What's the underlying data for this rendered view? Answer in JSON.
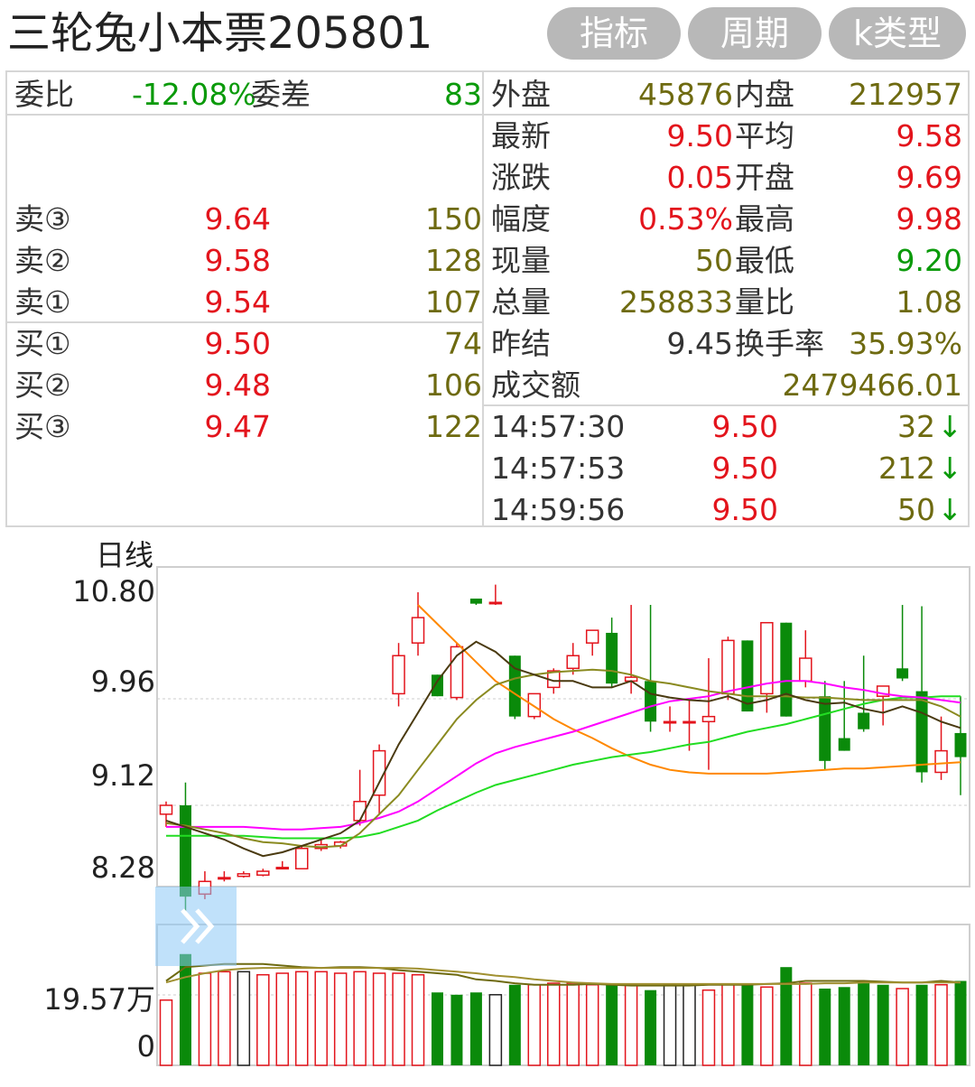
{
  "header": {
    "title": "三轮兔小本票205801",
    "buttons": [
      "指标",
      "周期",
      "k类型"
    ]
  },
  "order_book": {
    "weibi_label": "委比",
    "weibi_value": "-12.08%",
    "weicha_label": "委差",
    "weicha_value": "83",
    "sell": [
      {
        "label": "卖③",
        "price": "9.64",
        "volume": "150"
      },
      {
        "label": "卖②",
        "price": "9.58",
        "volume": "128"
      },
      {
        "label": "卖①",
        "price": "9.54",
        "volume": "107"
      }
    ],
    "buy": [
      {
        "label": "买①",
        "price": "9.50",
        "volume": "74"
      },
      {
        "label": "买②",
        "price": "9.48",
        "volume": "106"
      },
      {
        "label": "买③",
        "price": "9.47",
        "volume": "122"
      }
    ]
  },
  "stats": {
    "waipan_label": "外盘",
    "waipan_value": "45876",
    "neipan_label": "内盘",
    "neipan_value": "212957",
    "zuixin_label": "最新",
    "zuixin_value": "9.50",
    "pingjun_label": "平均",
    "pingjun_value": "9.58",
    "zhangdie_label": "涨跌",
    "zhangdie_value": "0.05",
    "kaipan_label": "开盘",
    "kaipan_value": "9.69",
    "fudu_label": "幅度",
    "fudu_value": "0.53%",
    "zuigao_label": "最高",
    "zuigao_value": "9.98",
    "xianliang_label": "现量",
    "xianliang_value": "50",
    "zuidi_label": "最低",
    "zuidi_value": "9.20",
    "zongliang_label": "总量",
    "zongliang_value": "258833",
    "liangbi_label": "量比",
    "liangbi_value": "1.08",
    "zuojie_label": "昨结",
    "zuojie_value": "9.45",
    "huanshou_label": "换手率",
    "huanshou_value": "35.93%",
    "chengjiao_label": "成交额",
    "chengjiao_value": "2479466.01"
  },
  "ticks": [
    {
      "time": "14:57:30",
      "price": "9.50",
      "volume": "32",
      "arrow": "↓"
    },
    {
      "time": "14:57:53",
      "price": "9.50",
      "volume": "212",
      "arrow": "↓"
    },
    {
      "time": "14:59:56",
      "price": "9.50",
      "volume": "50",
      "arrow": "↓"
    }
  ],
  "chart_data": {
    "type": "candlestick",
    "period_label": "日线",
    "price_axis": {
      "ticks": [
        "10.80",
        "9.96",
        "9.12",
        "8.28"
      ],
      "range": [
        8.28,
        10.8
      ]
    },
    "volume_axis": {
      "ticks": [
        "19.57万",
        "0"
      ]
    },
    "colors": {
      "up": "#e3141c",
      "down": "#0a8a0a",
      "ma5": "#4a3a10",
      "ma10": "#8a8a20",
      "ma20": "#ff00ff",
      "ma30": "#22dd22",
      "ma60": "#ff8800"
    },
    "candles": [
      {
        "o": 9.05,
        "h": 9.15,
        "l": 8.95,
        "c": 9.12
      },
      {
        "o": 9.12,
        "h": 9.3,
        "l": 8.25,
        "c": 8.4
      },
      {
        "o": 8.42,
        "h": 8.6,
        "l": 8.38,
        "c": 8.52
      },
      {
        "o": 8.55,
        "h": 8.6,
        "l": 8.52,
        "c": 8.55
      },
      {
        "o": 8.56,
        "h": 8.6,
        "l": 8.55,
        "c": 8.58
      },
      {
        "o": 8.57,
        "h": 8.62,
        "l": 8.56,
        "c": 8.6
      },
      {
        "o": 8.63,
        "h": 8.68,
        "l": 8.62,
        "c": 8.63
      },
      {
        "o": 8.62,
        "h": 8.8,
        "l": 8.62,
        "c": 8.78
      },
      {
        "o": 8.78,
        "h": 8.85,
        "l": 8.76,
        "c": 8.81
      },
      {
        "o": 8.8,
        "h": 8.84,
        "l": 8.78,
        "c": 8.83
      },
      {
        "o": 9.0,
        "h": 9.4,
        "l": 8.96,
        "c": 9.15
      },
      {
        "o": 9.2,
        "h": 9.6,
        "l": 9.05,
        "c": 9.55
      },
      {
        "o": 10.0,
        "h": 10.4,
        "l": 9.9,
        "c": 10.3
      },
      {
        "o": 10.4,
        "h": 10.8,
        "l": 10.3,
        "c": 10.6
      },
      {
        "o": 10.15,
        "h": 10.15,
        "l": 9.98,
        "c": 9.98
      },
      {
        "o": 9.97,
        "h": 10.4,
        "l": 9.95,
        "c": 10.37
      },
      {
        "o": 10.75,
        "h": 10.75,
        "l": 10.7,
        "c": 10.71
      },
      {
        "o": 10.72,
        "h": 10.86,
        "l": 10.7,
        "c": 10.72
      },
      {
        "o": 10.3,
        "h": 10.3,
        "l": 9.8,
        "c": 9.82
      },
      {
        "o": 9.82,
        "h": 10.0,
        "l": 9.8,
        "c": 10.0
      },
      {
        "o": 10.05,
        "h": 10.2,
        "l": 10.0,
        "c": 10.18
      },
      {
        "o": 10.2,
        "h": 10.4,
        "l": 10.15,
        "c": 10.3
      },
      {
        "o": 10.4,
        "h": 10.5,
        "l": 10.3,
        "c": 10.5
      },
      {
        "o": 10.48,
        "h": 10.6,
        "l": 10.05,
        "c": 10.08
      },
      {
        "o": 10.1,
        "h": 10.7,
        "l": 10.0,
        "c": 10.13
      },
      {
        "o": 10.1,
        "h": 10.7,
        "l": 9.7,
        "c": 9.78
      },
      {
        "o": 9.78,
        "h": 9.9,
        "l": 9.7,
        "c": 9.78
      },
      {
        "o": 9.78,
        "h": 9.95,
        "l": 9.55,
        "c": 9.78
      },
      {
        "o": 9.78,
        "h": 10.28,
        "l": 9.4,
        "c": 9.82
      },
      {
        "o": 10.0,
        "h": 10.45,
        "l": 9.95,
        "c": 10.42
      },
      {
        "o": 10.42,
        "h": 10.42,
        "l": 9.86,
        "c": 9.86
      },
      {
        "o": 10.0,
        "h": 10.56,
        "l": 9.85,
        "c": 10.56
      },
      {
        "o": 10.56,
        "h": 10.56,
        "l": 9.82,
        "c": 9.82
      },
      {
        "o": 10.1,
        "h": 10.5,
        "l": 10.05,
        "c": 10.28
      },
      {
        "o": 9.98,
        "h": 10.1,
        "l": 9.4,
        "c": 9.47
      },
      {
        "o": 9.65,
        "h": 10.1,
        "l": 9.55,
        "c": 9.55
      },
      {
        "o": 9.85,
        "h": 10.3,
        "l": 9.7,
        "c": 9.72
      },
      {
        "o": 9.98,
        "h": 10.06,
        "l": 9.75,
        "c": 10.06
      },
      {
        "o": 10.2,
        "h": 10.7,
        "l": 10.1,
        "c": 10.12
      },
      {
        "o": 10.02,
        "h": 10.69,
        "l": 9.3,
        "c": 9.38
      },
      {
        "o": 9.38,
        "h": 9.82,
        "l": 9.32,
        "c": 9.55
      },
      {
        "o": 9.69,
        "h": 9.98,
        "l": 9.2,
        "c": 9.5
      }
    ],
    "ma_lines": {
      "ma5": [
        9.0,
        8.95,
        8.9,
        8.85,
        8.78,
        8.72,
        8.75,
        8.8,
        8.85,
        8.9,
        9.0,
        9.3,
        9.6,
        9.85,
        10.1,
        10.3,
        10.41,
        10.33,
        10.2,
        10.15,
        10.1,
        10.1,
        10.05,
        10.05,
        10.1,
        10.0,
        9.97,
        9.95,
        9.94,
        9.98,
        9.92,
        9.95,
        10.0,
        9.95,
        9.92,
        9.93,
        9.88,
        9.85,
        9.9,
        9.85,
        9.78,
        9.73
      ],
      "ma10": [
        8.98,
        8.96,
        8.93,
        8.9,
        8.86,
        8.83,
        8.82,
        8.8,
        8.79,
        8.8,
        8.9,
        9.05,
        9.2,
        9.4,
        9.6,
        9.8,
        9.95,
        10.07,
        10.12,
        10.15,
        10.17,
        10.18,
        10.19,
        10.18,
        10.15,
        10.1,
        10.08,
        10.05,
        10.02,
        10.0,
        9.98,
        9.98,
        9.98,
        9.97,
        9.97,
        9.96,
        9.95,
        9.95,
        9.95,
        9.95,
        9.9,
        9.82
      ],
      "ma20": [
        8.95,
        8.95,
        8.95,
        8.95,
        8.95,
        8.94,
        8.93,
        8.93,
        8.94,
        8.95,
        8.98,
        9.02,
        9.07,
        9.15,
        9.25,
        9.35,
        9.45,
        9.53,
        9.58,
        9.62,
        9.66,
        9.7,
        9.75,
        9.8,
        9.85,
        9.9,
        9.94,
        9.96,
        9.98,
        10.02,
        10.05,
        10.08,
        10.1,
        10.1,
        10.08,
        10.05,
        10.03,
        10.0,
        9.98,
        9.97,
        9.95,
        9.93
      ],
      "ma30": [
        8.88,
        8.88,
        8.88,
        8.88,
        8.88,
        8.87,
        8.86,
        8.86,
        8.86,
        8.86,
        8.87,
        8.9,
        8.95,
        9.0,
        9.08,
        9.15,
        9.22,
        9.28,
        9.32,
        9.36,
        9.4,
        9.44,
        9.47,
        9.5,
        9.52,
        9.54,
        9.57,
        9.6,
        9.62,
        9.66,
        9.7,
        9.73,
        9.76,
        9.8,
        9.84,
        9.88,
        9.92,
        9.95,
        9.97,
        9.97,
        9.98,
        9.98
      ],
      "ma60": [
        null,
        null,
        null,
        null,
        null,
        null,
        null,
        null,
        null,
        null,
        null,
        null,
        null,
        10.7,
        10.55,
        10.4,
        10.25,
        10.1,
        10.0,
        9.9,
        9.8,
        9.72,
        9.65,
        9.57,
        9.5,
        9.44,
        9.4,
        9.38,
        9.37,
        9.37,
        9.37,
        9.37,
        9.38,
        9.39,
        9.4,
        9.41,
        9.41,
        9.42,
        9.43,
        9.44,
        9.45,
        9.46
      ]
    },
    "volumes": [
      0.85,
      1.45,
      1.2,
      1.22,
      1.22,
      1.18,
      1.2,
      1.22,
      1.22,
      1.2,
      1.22,
      1.2,
      1.2,
      1.18,
      0.95,
      0.92,
      0.95,
      0.92,
      1.05,
      1.05,
      1.07,
      1.07,
      1.05,
      1.05,
      1.05,
      0.98,
      1.05,
      1.05,
      0.98,
      1.05,
      1.05,
      1.02,
      1.28,
      1.07,
      1.0,
      1.02,
      1.07,
      1.05,
      1.0,
      1.05,
      1.05,
      1.1
    ],
    "vol_ma": [
      1.1,
      1.28,
      1.3,
      1.32,
      1.32,
      1.32,
      1.3,
      1.28,
      1.27,
      1.28,
      1.28,
      1.27,
      1.24,
      1.22,
      1.2,
      1.18,
      1.12,
      1.1,
      1.07,
      1.05,
      1.05,
      1.05,
      1.06,
      1.05,
      1.04,
      1.04,
      1.04,
      1.04,
      1.05,
      1.05,
      1.05,
      1.06,
      1.07,
      1.1,
      1.1,
      1.1,
      1.1,
      1.09,
      1.08,
      1.08,
      1.1,
      1.08
    ],
    "vol_ma2": [
      1.08,
      1.15,
      1.2,
      1.24,
      1.26,
      1.27,
      1.27,
      1.27,
      1.27,
      1.27,
      1.27,
      1.27,
      1.27,
      1.26,
      1.24,
      1.22,
      1.2,
      1.17,
      1.15,
      1.12,
      1.1,
      1.08,
      1.07,
      1.06,
      1.06,
      1.06,
      1.06,
      1.06,
      1.06,
      1.06,
      1.06,
      1.06,
      1.06,
      1.06,
      1.07,
      1.07,
      1.08,
      1.08,
      1.08,
      1.08,
      1.08,
      1.08
    ],
    "vol_up_flags": [
      1,
      0,
      1,
      1,
      2,
      1,
      1,
      1,
      1,
      1,
      1,
      1,
      1,
      1,
      0,
      0,
      0,
      2,
      0,
      1,
      1,
      1,
      1,
      0,
      1,
      0,
      2,
      2,
      1,
      1,
      0,
      1,
      0,
      1,
      0,
      0,
      0,
      0,
      1,
      0,
      1,
      0
    ]
  }
}
